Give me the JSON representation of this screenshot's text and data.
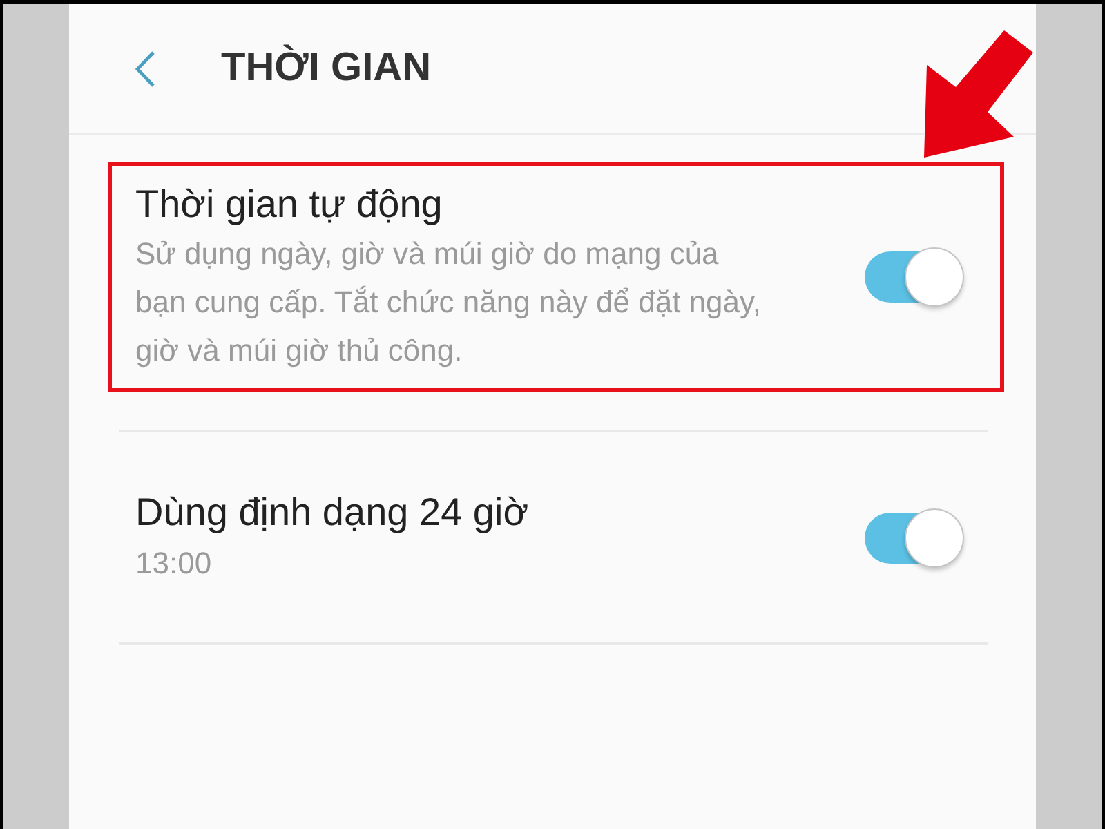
{
  "header": {
    "title": "THỜI GIAN"
  },
  "settings": [
    {
      "title": "Thời gian tự động",
      "summary": "Sử dụng ngày, giờ và múi giờ do mạng của bạn cung cấp. Tắt chức năng này để đặt ngày, giờ và múi giờ thủ công.",
      "on": true,
      "highlighted": true
    },
    {
      "title": "Dùng định dạng 24 giờ",
      "summary": "13:00",
      "on": true,
      "highlighted": false
    }
  ]
}
